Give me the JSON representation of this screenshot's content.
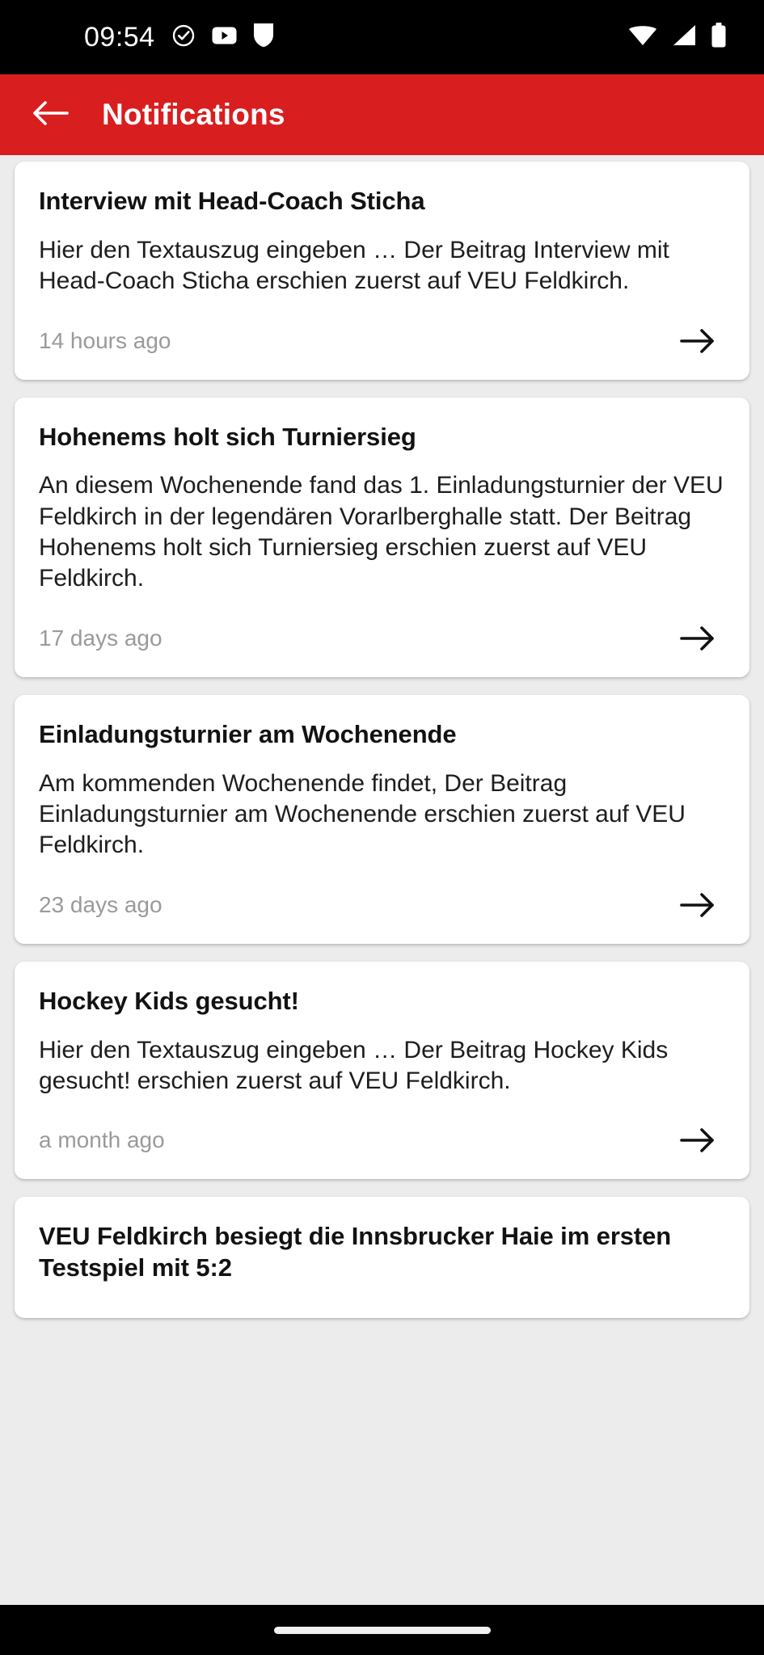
{
  "status_bar": {
    "time": "09:54",
    "left_icons": [
      "check-circle-icon",
      "youtube-icon",
      "shield-icon"
    ],
    "right_icons": [
      "wifi-icon",
      "cellular-signal-icon",
      "battery-icon"
    ],
    "background_color": "#000000",
    "foreground_color": "#ffffff"
  },
  "header": {
    "title": "Notifications",
    "back_icon": "arrow-left-icon",
    "background_color": "#d81e1e",
    "text_color": "#ffffff"
  },
  "theme": {
    "page_background": "#ececec",
    "card_background": "#ffffff",
    "title_color": "#121212",
    "body_color": "#1d1d1d",
    "timestamp_color": "#9a9a9a",
    "accent_color": "#d81e1e"
  },
  "notifications": [
    {
      "title": "Interview mit Head-Coach Sticha",
      "body": "Hier den Textauszug eingeben … Der Beitrag Interview mit Head-Coach Sticha erschien zuerst auf VEU Feldkirch.",
      "time": "14 hours ago",
      "action_icon": "arrow-right-icon"
    },
    {
      "title": "Hohenems holt sich Turniersieg",
      "body": "An diesem Wochenende fand das 1. Einladungsturnier der VEU Feldkirch in der legendären Vorarlberghalle statt. Der Beitrag Hohenems holt sich Turniersieg erschien zuerst auf VEU Feldkirch.",
      "time": "17 days ago",
      "action_icon": "arrow-right-icon"
    },
    {
      "title": "Einladungsturnier am Wochenende",
      "body": "Am kommenden Wochenende findet, Der Beitrag Einladungsturnier am Wochenende erschien zuerst auf VEU Feldkirch.",
      "time": "23 days ago",
      "action_icon": "arrow-right-icon"
    },
    {
      "title": "Hockey Kids gesucht!",
      "body": "Hier den Textauszug eingeben … Der Beitrag Hockey Kids gesucht! erschien zuerst auf VEU Feldkirch.",
      "time": "a month ago",
      "action_icon": "arrow-right-icon"
    },
    {
      "title": "VEU Feldkirch besiegt die Innsbrucker Haie im ersten Testspiel mit 5:2",
      "body": "",
      "time": "",
      "action_icon": "arrow-right-icon"
    }
  ],
  "nav_bar": {
    "gesture_pill": "home-gesture-pill",
    "background_color": "#000000"
  }
}
